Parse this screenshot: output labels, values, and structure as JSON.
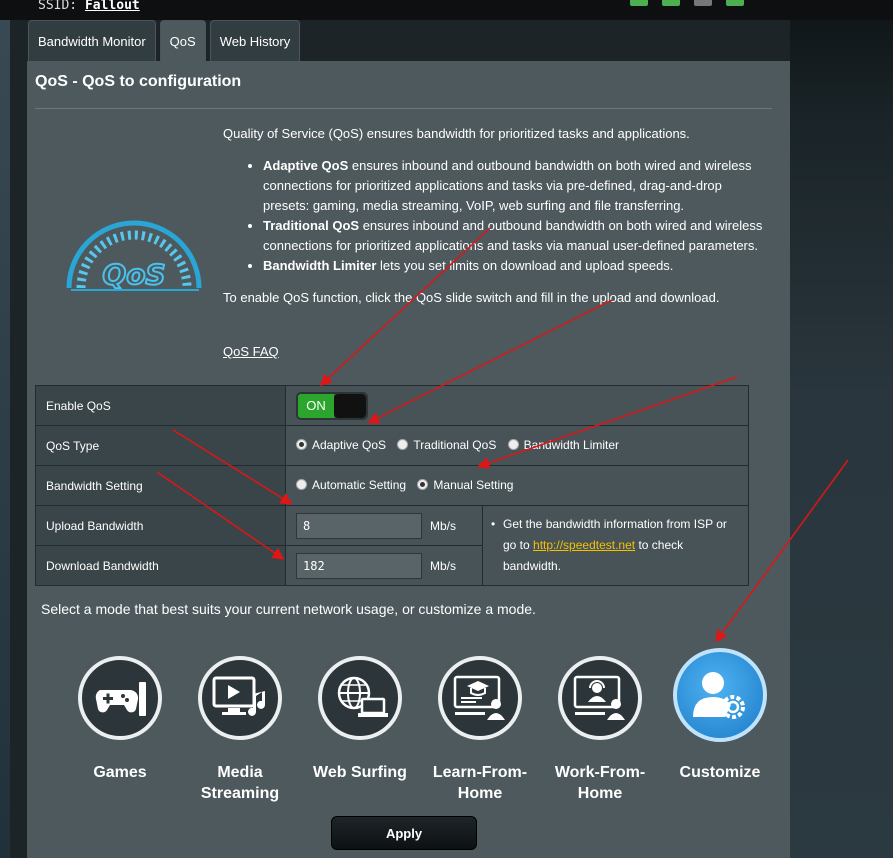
{
  "header": {
    "ssid_label": "SSID:",
    "ssid_value": "Fallout"
  },
  "tabs": [
    {
      "label": "Bandwidth Monitor"
    },
    {
      "label": "QoS"
    },
    {
      "label": "Web History"
    }
  ],
  "page": {
    "title": "QoS - QoS to configuration"
  },
  "description": {
    "intro": "Quality of Service (QoS) ensures bandwidth for prioritized tasks and applications.",
    "bullets": [
      {
        "bold": "Adaptive QoS",
        "text": " ensures inbound and outbound bandwidth on both wired and wireless connections for prioritized applications and tasks via pre-defined, drag-and-drop presets: gaming, media streaming, VoIP, web surfing and file transferring."
      },
      {
        "bold": "Traditional QoS",
        "text": " ensures inbound and outbound bandwidth on both wired and wireless connections for prioritized applications and tasks via manual user-defined parameters."
      },
      {
        "bold": "Bandwidth Limiter",
        "text": " lets you set limits on download and upload speeds."
      }
    ],
    "enable_hint": "To enable QoS function, click the QoS slide switch and fill in the upload and download.",
    "faq_link": "QoS FAQ"
  },
  "config": {
    "enable_qos": {
      "label": "Enable QoS",
      "state": "ON"
    },
    "qos_type": {
      "label": "QoS Type",
      "options": [
        "Adaptive QoS",
        "Traditional QoS",
        "Bandwidth Limiter"
      ],
      "selected": "Adaptive QoS"
    },
    "bandwidth_setting": {
      "label": "Bandwidth Setting",
      "options": [
        "Automatic Setting",
        "Manual Setting"
      ],
      "selected": "Manual Setting"
    },
    "upload": {
      "label": "Upload Bandwidth",
      "value": "8",
      "unit": "Mb/s"
    },
    "download": {
      "label": "Download Bandwidth",
      "value": "182",
      "unit": "Mb/s"
    },
    "note": {
      "bullet": "•",
      "text1": "Get the bandwidth information from ISP or go to ",
      "link": "http://speedtest.net",
      "text2": " to check bandwidth."
    }
  },
  "modes": {
    "prompt": "Select a mode that best suits your current network usage, or customize a mode.",
    "items": [
      {
        "label": "Games",
        "icon": "gamepad-icon"
      },
      {
        "label": "Media Streaming",
        "icon": "media-icon"
      },
      {
        "label": "Web Surfing",
        "icon": "globe-laptop-icon"
      },
      {
        "label": "Learn-From-Home",
        "icon": "learn-icon"
      },
      {
        "label": "Work-From-Home",
        "icon": "work-icon"
      },
      {
        "label": "Customize",
        "icon": "user-gear-icon",
        "selected": true
      }
    ]
  },
  "apply_label": "Apply",
  "colors": {
    "panel": "#4d595d",
    "switch_on": "#2ba52b",
    "link": "#f5c000",
    "arrow": "#e01515",
    "customize": "#2a8fe0"
  }
}
